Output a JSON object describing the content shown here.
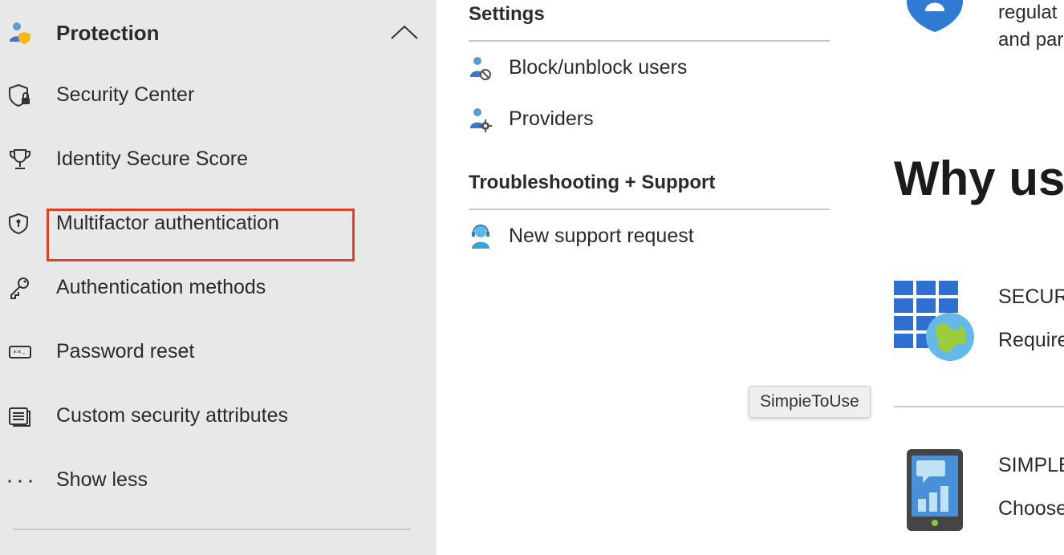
{
  "sidebar": {
    "header": {
      "label": "Protection",
      "icon": "user-shield-icon",
      "chevron": "chevron-up-icon"
    },
    "items": [
      {
        "label": "Security Center",
        "icon": "shield-lock-icon"
      },
      {
        "label": "Identity Secure Score",
        "icon": "trophy-icon"
      },
      {
        "label": "Multifactor authentication",
        "icon": "shield-keyhole-icon",
        "highlighted": true
      },
      {
        "label": "Authentication methods",
        "icon": "key-icon"
      },
      {
        "label": "Password reset",
        "icon": "password-icon"
      },
      {
        "label": "Custom security attributes",
        "icon": "attributes-icon"
      },
      {
        "label": "Show less",
        "icon": "more-icon"
      }
    ],
    "highlight_color": "#e0402a"
  },
  "settings": {
    "title": "Settings",
    "items": [
      {
        "label": "Block/unblock users",
        "icon": "block-user-icon"
      },
      {
        "label": "Providers",
        "icon": "user-gear-icon"
      }
    ]
  },
  "support": {
    "title": "Troubleshooting + Support",
    "items": [
      {
        "label": "New support request",
        "icon": "support-agent-icon"
      }
    ]
  },
  "right_panel": {
    "hero_text_line1": "regulat",
    "hero_text_line2": "and par",
    "heading": "Why use",
    "features": [
      {
        "title": "SECUR",
        "desc": "Require",
        "icon": "windows-globe-icon"
      },
      {
        "title": "SIMPLE",
        "desc": "Choose",
        "icon": "phone-chart-icon"
      }
    ]
  },
  "tooltip": {
    "text": "SimpieToUse"
  }
}
